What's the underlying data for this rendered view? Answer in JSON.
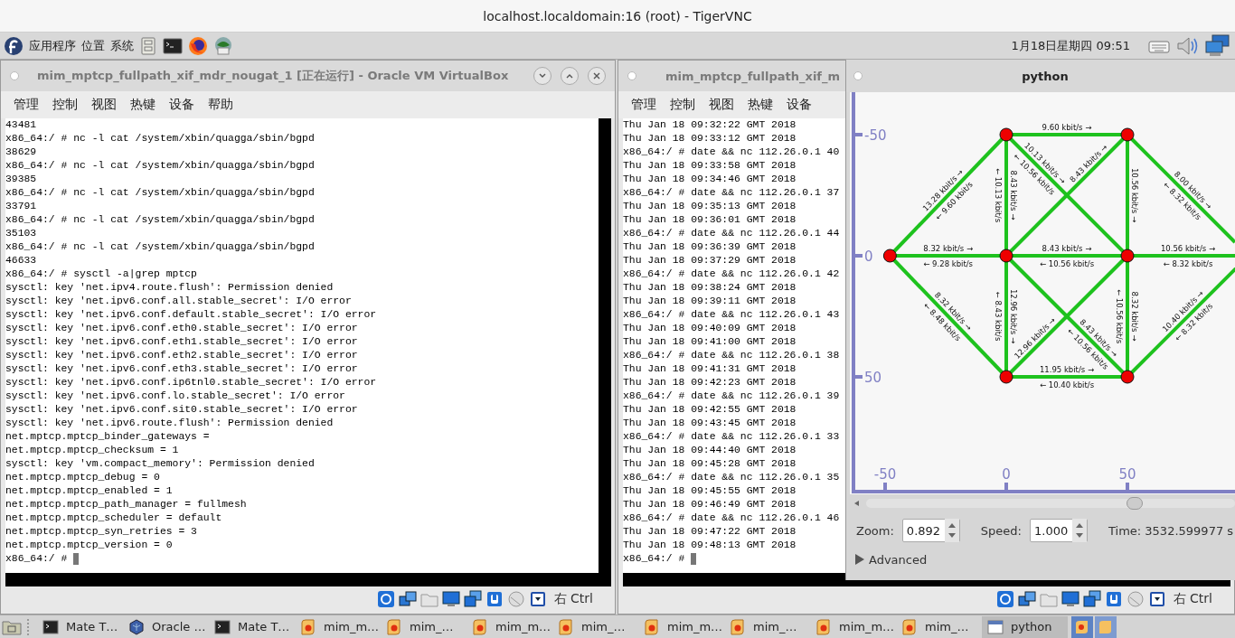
{
  "vnc_title": "localhost.localdomain:16 (root) - TigerVNC",
  "panel": {
    "menus": [
      "应用程序",
      "位置",
      "系统"
    ],
    "clock": "1月18日星期四 09:51"
  },
  "vbox_windows": [
    {
      "title": "mim_mptcp_fullpath_xif_mdr_nougat_1 [正在运行] - Oracle VM VirtualBox",
      "menu": [
        "管理",
        "控制",
        "视图",
        "热键",
        "设备",
        "帮助"
      ],
      "host_key": "右 Ctrl",
      "terminal_lines": [
        "43481",
        "x86_64:/ # nc -l cat /system/xbin/quagga/sbin/bgpd",
        "38629",
        "x86_64:/ # nc -l cat /system/xbin/quagga/sbin/bgpd",
        "39385",
        "x86_64:/ # nc -l cat /system/xbin/quagga/sbin/bgpd",
        "33791",
        "x86_64:/ # nc -l cat /system/xbin/quagga/sbin/bgpd",
        "35103",
        "x86_64:/ # nc -l cat /system/xbin/quagga/sbin/bgpd",
        "46633",
        "x86_64:/ # sysctl -a|grep mptcp",
        "sysctl: key 'net.ipv4.route.flush': Permission denied",
        "sysctl: key 'net.ipv6.conf.all.stable_secret': I/O error",
        "sysctl: key 'net.ipv6.conf.default.stable_secret': I/O error",
        "sysctl: key 'net.ipv6.conf.eth0.stable_secret': I/O error",
        "sysctl: key 'net.ipv6.conf.eth1.stable_secret': I/O error",
        "sysctl: key 'net.ipv6.conf.eth2.stable_secret': I/O error",
        "sysctl: key 'net.ipv6.conf.eth3.stable_secret': I/O error",
        "sysctl: key 'net.ipv6.conf.ip6tnl0.stable_secret': I/O error",
        "sysctl: key 'net.ipv6.conf.lo.stable_secret': I/O error",
        "sysctl: key 'net.ipv6.conf.sit0.stable_secret': I/O error",
        "sysctl: key 'net.ipv6.route.flush': Permission denied",
        "net.mptcp.mptcp_binder_gateways =",
        "net.mptcp.mptcp_checksum = 1",
        "sysctl: key 'vm.compact_memory': Permission denied",
        "net.mptcp.mptcp_debug = 0",
        "net.mptcp.mptcp_enabled = 1",
        "net.mptcp.mptcp_path_manager = fullmesh",
        "net.mptcp.mptcp_scheduler = default",
        "net.mptcp.mptcp_syn_retries = 3",
        "net.mptcp.mptcp_version = 0",
        "x86_64:/ #"
      ]
    },
    {
      "title": "mim_mptcp_fullpath_xif_m",
      "menu": [
        "管理",
        "控制",
        "视图",
        "热键",
        "设备"
      ],
      "host_key": "右 Ctrl",
      "terminal_lines": [
        "Thu Jan 18 09:32:22 GMT 2018",
        "Thu Jan 18 09:33:12 GMT 2018",
        "x86_64:/ # date && nc 112.26.0.1 40",
        "Thu Jan 18 09:33:58 GMT 2018",
        "Thu Jan 18 09:34:46 GMT 2018",
        "x86_64:/ # date && nc 112.26.0.1 37",
        "Thu Jan 18 09:35:13 GMT 2018",
        "Thu Jan 18 09:36:01 GMT 2018",
        "x86_64:/ # date && nc 112.26.0.1 44",
        "Thu Jan 18 09:36:39 GMT 2018",
        "Thu Jan 18 09:37:29 GMT 2018",
        "x86_64:/ # date && nc 112.26.0.1 42",
        "Thu Jan 18 09:38:24 GMT 2018",
        "Thu Jan 18 09:39:11 GMT 2018",
        "x86_64:/ # date && nc 112.26.0.1 43",
        "Thu Jan 18 09:40:09 GMT 2018",
        "Thu Jan 18 09:41:00 GMT 2018",
        "x86_64:/ # date && nc 112.26.0.1 38",
        "Thu Jan 18 09:41:31 GMT 2018",
        "Thu Jan 18 09:42:23 GMT 2018",
        "x86_64:/ # date && nc 112.26.0.1 39",
        "Thu Jan 18 09:42:55 GMT 2018",
        "Thu Jan 18 09:43:45 GMT 2018",
        "x86_64:/ # date && nc 112.26.0.1 33",
        "Thu Jan 18 09:44:40 GMT 2018",
        "Thu Jan 18 09:45:28 GMT 2018",
        "x86_64:/ # date && nc 112.26.0.1 35",
        "Thu Jan 18 09:45:55 GMT 2018",
        "Thu Jan 18 09:46:49 GMT 2018",
        "x86_64:/ # date && nc 112.26.0.1 46",
        "Thu Jan 18 09:47:22 GMT 2018",
        "Thu Jan 18 09:48:13 GMT 2018",
        "x86_64:/ #"
      ]
    }
  ],
  "python_window": {
    "title": "python",
    "graph": {
      "y_ticks": [
        "-50",
        "0",
        "50"
      ],
      "x_ticks": [
        "-50",
        "0",
        "50"
      ],
      "edges": [
        {
          "forward": "13.28 kbit/s →",
          "backward": "← 9.60 kbit/s"
        },
        {
          "forward": "9.60 kbit/s →"
        },
        {
          "forward": "8.43 kbit/s →",
          "backward": "← 10.13 kbit/s"
        },
        {
          "forward": "10.13 kbit/s →",
          "backward": "← 10.56 kbit/s"
        },
        {
          "forward": "8.43 kbit/s →"
        },
        {
          "forward": "10.56 kbit/s →"
        },
        {
          "forward": "8.00 kbit/s →",
          "backward": "← 8.32 kbit/s"
        },
        {
          "forward": "8.32 kbit/s →",
          "backward": "← 9.28 kbit/s"
        },
        {
          "forward": "8.43 kbit/s →",
          "backward": "← 10.56 kbit/s"
        },
        {
          "forward": "10.56 kbit/s →",
          "backward": "← 8.32 kbit/s"
        },
        {
          "forward": "8.32 kbit/s →",
          "backward": "← 8.48 kbit/s"
        },
        {
          "forward": "12.96 kbit/s →",
          "backward": "← 8.43 kbit/s"
        },
        {
          "forward": "8.43 kbit/s →",
          "backward": "← 10.56 kbit/s"
        },
        {
          "forward": "12.96 kbit/s →"
        },
        {
          "forward": "8.32 kbit/s →",
          "backward": "← 10.56 kbit/s"
        },
        {
          "forward": "11.95 kbit/s →",
          "backward": "← 10.40 kbit/s"
        },
        {
          "forward": "10.40 kbit/s →",
          "backward": "← 8.32 kbit/s"
        }
      ]
    },
    "zoom_label": "Zoom:",
    "zoom_value": "0.892",
    "speed_label": "Speed:",
    "speed_value": "1.000",
    "time": "Time: 3532.599977 s",
    "advanced": {
      "label": "Advanced",
      "expanded": false
    }
  },
  "taskbar": [
    {
      "label": "Mate T…",
      "kind": "terminal",
      "selected": false
    },
    {
      "label": "Oracle …",
      "kind": "vbox",
      "selected": false
    },
    {
      "label": "Mate T…",
      "kind": "terminal",
      "selected": false
    },
    {
      "label": "mim_m…",
      "kind": "app",
      "selected": false
    },
    {
      "label": "mim_…",
      "kind": "app",
      "selected": false
    },
    {
      "label": "mim_m…",
      "kind": "app",
      "selected": false
    },
    {
      "label": "mim_…",
      "kind": "app",
      "selected": false
    },
    {
      "label": "mim_m…",
      "kind": "app",
      "selected": false
    },
    {
      "label": "mim_…",
      "kind": "app",
      "selected": false
    },
    {
      "label": "mim_m…",
      "kind": "app",
      "selected": false
    },
    {
      "label": "mim_…",
      "kind": "app",
      "selected": false
    },
    {
      "label": "python",
      "kind": "window",
      "selected": true
    }
  ]
}
